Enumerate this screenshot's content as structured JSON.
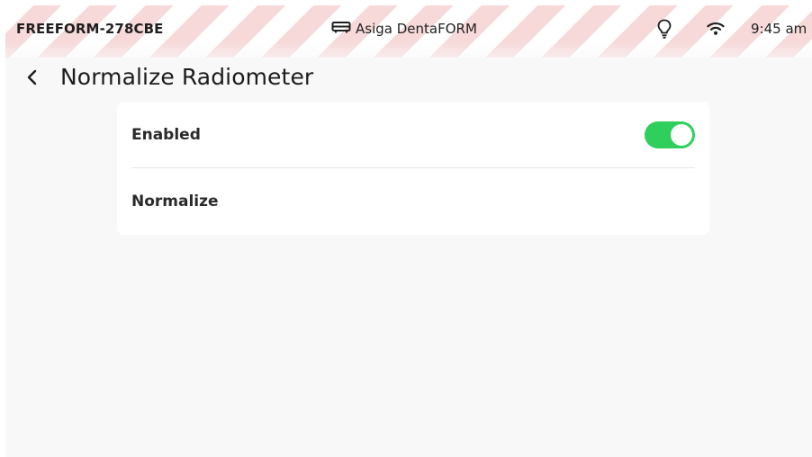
{
  "status_bar": {
    "device_id": "FREEFORM-278CBE",
    "printer_name": "Asiga DentaFORM",
    "printer_icon": "printer-icon",
    "light_icon": "lightbulb-icon",
    "wifi_icon": "wifi-icon",
    "time": "9:45 am"
  },
  "header": {
    "back_icon": "chevron-left-icon",
    "title": "Normalize Radiometer"
  },
  "settings": {
    "enabled_label": "Enabled",
    "enabled_value": true,
    "normalize_label": "Normalize"
  },
  "colors": {
    "toggle_on": "#2fcf5c",
    "stripe": "#f7d9d9",
    "background": "#f8f8f8",
    "card": "#ffffff"
  }
}
